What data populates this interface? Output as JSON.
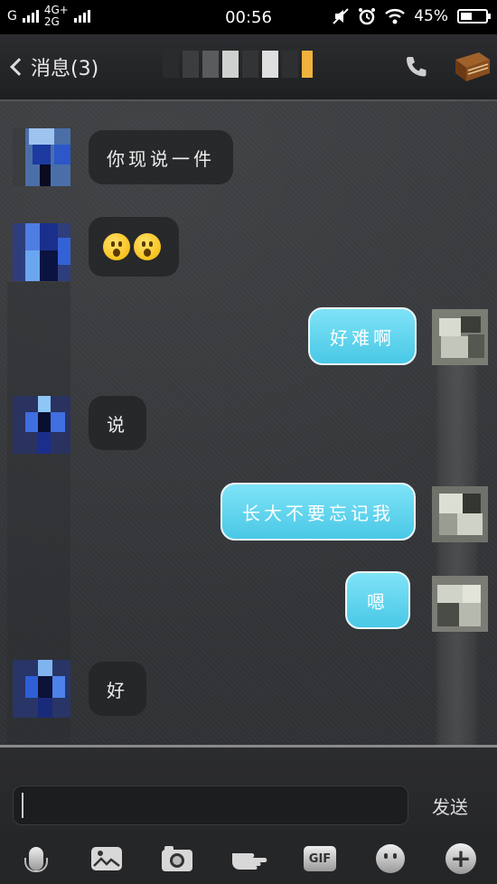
{
  "status_bar": {
    "carrier_left": "G",
    "net_top": "4G+",
    "net_bottom": "2G",
    "time": "00:56",
    "battery_text": "45%",
    "battery_level": 0.45
  },
  "header": {
    "back_label": "消息(3)"
  },
  "messages": [
    {
      "side": "in",
      "text": "你现说一件"
    },
    {
      "side": "in",
      "text": "",
      "emoji_count": 2
    },
    {
      "side": "out",
      "text": "好难啊"
    },
    {
      "side": "in",
      "text": "说"
    },
    {
      "side": "out",
      "text": "长大不要忘记我"
    },
    {
      "side": "out",
      "text": "嗯"
    },
    {
      "side": "in",
      "text": "好"
    }
  ],
  "input": {
    "value": "",
    "send_label": "发送"
  },
  "toolbar": {
    "gif_label": "GIF"
  },
  "colors": {
    "outgoing_bubble": "#49c8e6",
    "incoming_bubble": "#232426",
    "background": "#333436"
  }
}
